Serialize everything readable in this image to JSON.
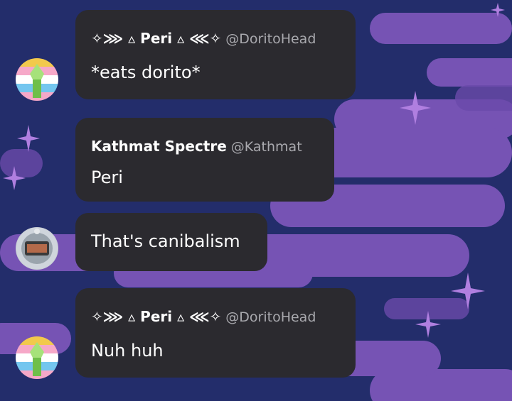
{
  "colors": {
    "background_dark": "#232d6b",
    "cloud_purple": "#8a5fc4",
    "bubble": "#2b2a2f",
    "handle": "#a9a9ae",
    "sparkle": "#b07fe0"
  },
  "messages": [
    {
      "author": "✧⋙ ▵ Peri ▵ ⋘✧",
      "handle": "@DoritoHead",
      "text": "*eats dorito*",
      "avatar": "peri-flag-avatar"
    },
    {
      "author": "Kathmat Spectre",
      "handle": "@Kathmat",
      "text": "Peri",
      "avatar": "kathmat-avatar"
    },
    {
      "text": "That's canibalism"
    },
    {
      "author": "✧⋙ ▵ Peri ▵ ⋘✧",
      "handle": "@DoritoHead",
      "text": "Nuh huh",
      "avatar": "peri-flag-avatar"
    }
  ]
}
